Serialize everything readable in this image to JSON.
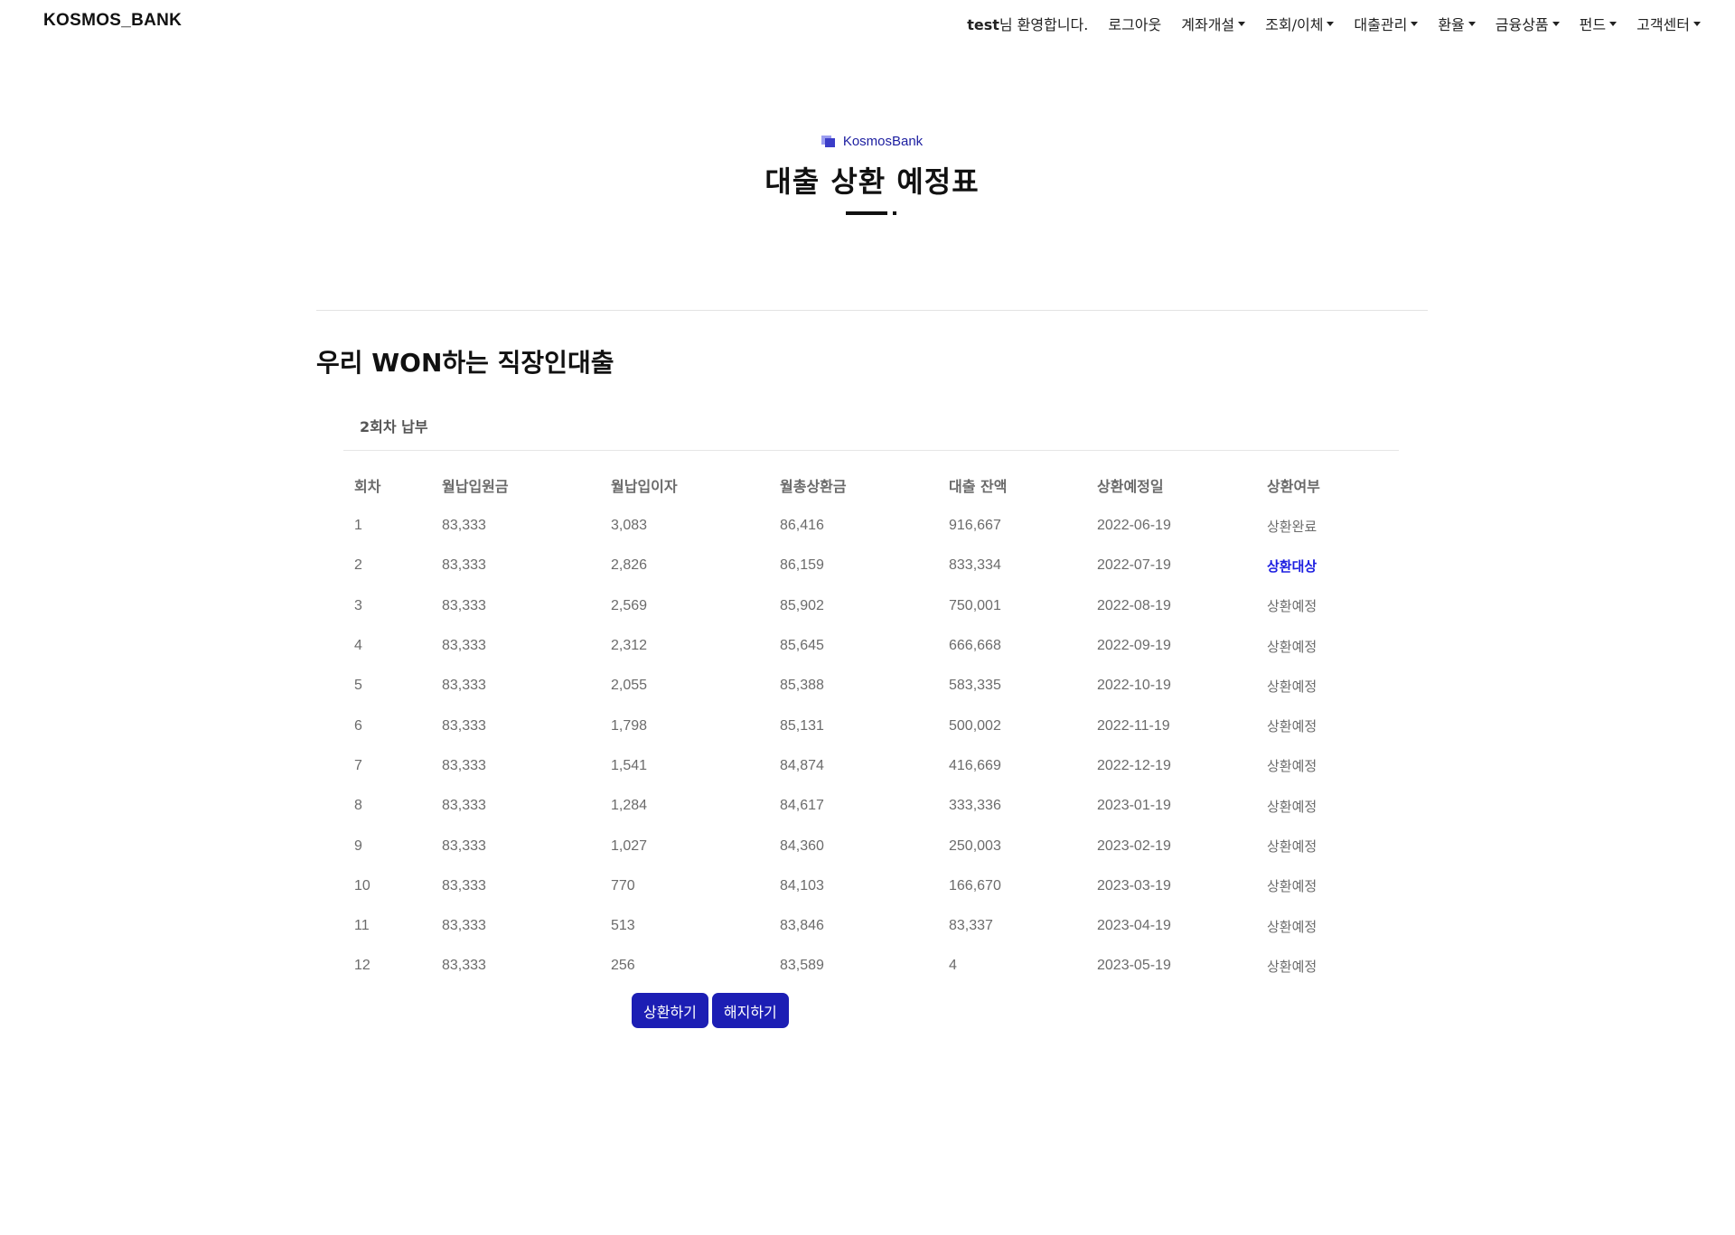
{
  "brand": "KOSMOS_BANK",
  "nav": {
    "user": "test",
    "welcome_suffix": "님 환영합니다.",
    "logout": "로그아웃",
    "menus": [
      "계좌개설",
      "조회/이체",
      "대출관리",
      "환율",
      "금융상품",
      "펀드",
      "고객센터"
    ]
  },
  "header": {
    "subtitle": "KosmosBank",
    "title": "대출 상환 예정표"
  },
  "product_name": "우리 WON하는 직장인대출",
  "round_label": "2회차 납부",
  "table": {
    "columns": [
      "회차",
      "월납입원금",
      "월납입이자",
      "월총상환금",
      "대출 잔액",
      "상환예정일",
      "상환여부"
    ],
    "rows": [
      [
        "1",
        "83,333",
        "3,083",
        "86,416",
        "916,667",
        "2022-06-19",
        "상환완료"
      ],
      [
        "2",
        "83,333",
        "2,826",
        "86,159",
        "833,334",
        "2022-07-19",
        "상환대상"
      ],
      [
        "3",
        "83,333",
        "2,569",
        "85,902",
        "750,001",
        "2022-08-19",
        "상환예정"
      ],
      [
        "4",
        "83,333",
        "2,312",
        "85,645",
        "666,668",
        "2022-09-19",
        "상환예정"
      ],
      [
        "5",
        "83,333",
        "2,055",
        "85,388",
        "583,335",
        "2022-10-19",
        "상환예정"
      ],
      [
        "6",
        "83,333",
        "1,798",
        "85,131",
        "500,002",
        "2022-11-19",
        "상환예정"
      ],
      [
        "7",
        "83,333",
        "1,541",
        "84,874",
        "416,669",
        "2022-12-19",
        "상환예정"
      ],
      [
        "8",
        "83,333",
        "1,284",
        "84,617",
        "333,336",
        "2023-01-19",
        "상환예정"
      ],
      [
        "9",
        "83,333",
        "1,027",
        "84,360",
        "250,003",
        "2023-02-19",
        "상환예정"
      ],
      [
        "10",
        "83,333",
        "770",
        "84,103",
        "166,670",
        "2023-03-19",
        "상환예정"
      ],
      [
        "11",
        "83,333",
        "513",
        "83,846",
        "83,337",
        "2023-04-19",
        "상환예정"
      ],
      [
        "12",
        "83,333",
        "256",
        "83,589",
        "4",
        "2023-05-19",
        "상환예정"
      ]
    ]
  },
  "buttons": {
    "repay": "상환하기",
    "cancel": "해지하기"
  },
  "colors": {
    "accent": "#1c1eb4",
    "target_status": "#1c1ee0"
  }
}
